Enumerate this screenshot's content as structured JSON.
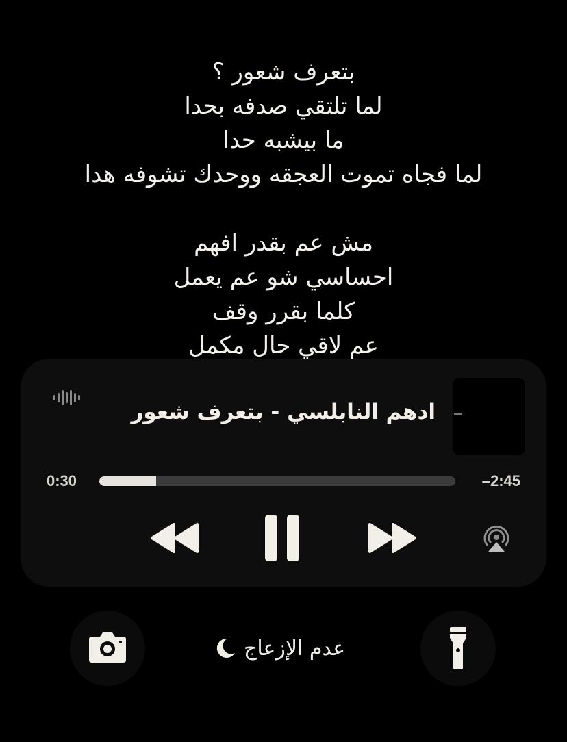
{
  "lyrics": {
    "stanza1": [
      "بتعرف شعور ؟",
      "لما تلتقي صدفه بحدا",
      "ما بيشبه حدا",
      "لما فجاه تموت العجقه ووحدك تشوفه هدا"
    ],
    "stanza2": [
      "مش عم بقدر افهم",
      "احساسي شو عم يعمل",
      "كلما بقرر وقف",
      "عم لاقي حال مكمل"
    ]
  },
  "player": {
    "track_title": "ادهم النابلسي - بتعرف شعور",
    "elapsed": "0:30",
    "remaining": "–2:45",
    "progress": 0.16,
    "state": "playing",
    "icons": {
      "waveform": "waveform-icon",
      "rewind": "rewind-icon",
      "pause": "pause-icon",
      "forward": "fast-forward-icon",
      "airplay": "airplay-audio-icon"
    }
  },
  "bottom_bar": {
    "focus_label": "عدم الإزعاج",
    "focus_icon": "moon-icon",
    "left_button_icon": "camera-icon",
    "right_button_icon": "flashlight-icon"
  },
  "colors": {
    "background": "#000000",
    "player_bg": "#0e0e0e",
    "text": "#f2efe9",
    "progress_track": "#3b3b3b",
    "progress_fill": "#e6e3dd"
  }
}
